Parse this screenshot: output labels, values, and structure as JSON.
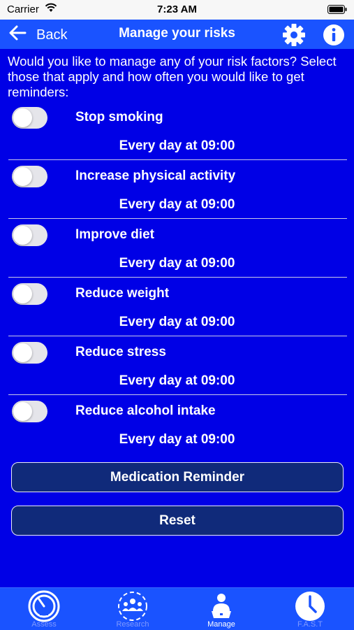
{
  "status": {
    "carrier": "Carrier",
    "time": "7:23 AM"
  },
  "nav": {
    "back_label": "Back",
    "title": "Manage your risks",
    "settings_icon": "gear-icon",
    "info_icon": "info-icon"
  },
  "intro": "Would you like to manage any of your risk factors? Select those that apply and how often you would like to get reminders:",
  "risks": [
    {
      "label": "Stop smoking",
      "frequency": "Every day at 09:00",
      "enabled": false
    },
    {
      "label": "Increase physical activity",
      "frequency": "Every day at 09:00",
      "enabled": false
    },
    {
      "label": "Improve diet",
      "frequency": "Every day at 09:00",
      "enabled": false
    },
    {
      "label": "Reduce weight",
      "frequency": "Every day at 09:00",
      "enabled": false
    },
    {
      "label": "Reduce stress",
      "frequency": "Every day at 09:00",
      "enabled": false
    },
    {
      "label": "Reduce alcohol intake",
      "frequency": "Every day at 09:00",
      "enabled": false
    }
  ],
  "buttons": {
    "medication": "Medication Reminder",
    "reset": "Reset"
  },
  "tabs": [
    {
      "label": "Assess",
      "icon": "gauge-icon",
      "active": false
    },
    {
      "label": "Research",
      "icon": "people-icon",
      "active": false
    },
    {
      "label": "Manage",
      "icon": "person-laptop-icon",
      "active": true
    },
    {
      "label": "F.A.S.T",
      "icon": "clock-icon",
      "active": false
    }
  ],
  "colors": {
    "background": "#0000e6",
    "bar": "#1a53ff",
    "button": "#102a7a"
  }
}
